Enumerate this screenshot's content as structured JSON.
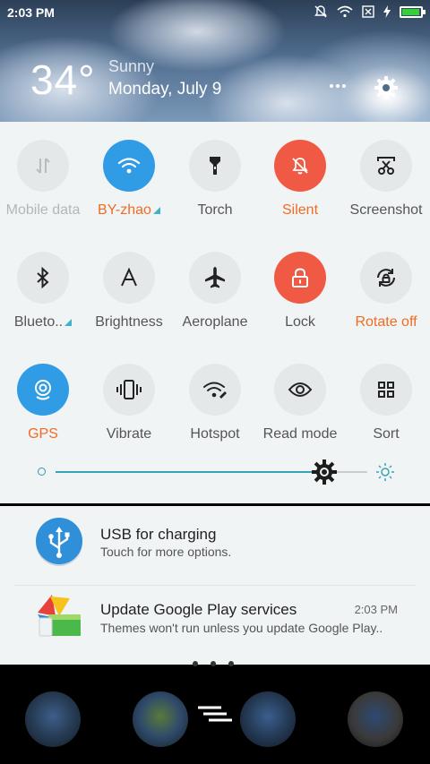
{
  "status_bar": {
    "time": "2:03 PM",
    "icons": [
      "mute-bell-icon",
      "wifi-icon",
      "no-sim-icon",
      "charging-icon",
      "battery-icon"
    ],
    "battery_color": "#35d036"
  },
  "weather": {
    "temperature": "34°",
    "condition": "Sunny",
    "date": "Monday, July 9"
  },
  "header_icons": [
    "more-icon",
    "gear-icon"
  ],
  "tiles": [
    {
      "label": "Mobile data",
      "icon": "mobile-data-icon",
      "state": "disabled"
    },
    {
      "label": "BY-zhao",
      "icon": "wifi-icon",
      "state": "on"
    },
    {
      "label": "Torch",
      "icon": "torch-icon",
      "state": "off"
    },
    {
      "label": "Silent",
      "icon": "silent-bell-icon",
      "state": "on"
    },
    {
      "label": "Screenshot",
      "icon": "scissors-icon",
      "state": "off"
    },
    {
      "label": "Blueto..",
      "icon": "bluetooth-icon",
      "state": "off"
    },
    {
      "label": "Brightness",
      "icon": "auto-brightness-icon",
      "state": "off"
    },
    {
      "label": "Aeroplane",
      "icon": "aeroplane-icon",
      "state": "off"
    },
    {
      "label": "Lock",
      "icon": "lock-icon",
      "state": "on"
    },
    {
      "label": "Rotate off",
      "icon": "rotate-lock-icon",
      "state": "on"
    },
    {
      "label": "GPS",
      "icon": "gps-icon",
      "state": "on"
    },
    {
      "label": "Vibrate",
      "icon": "vibrate-icon",
      "state": "off"
    },
    {
      "label": "Hotspot",
      "icon": "hotspot-icon",
      "state": "off"
    },
    {
      "label": "Read mode",
      "icon": "eye-icon",
      "state": "off"
    },
    {
      "label": "Sort",
      "icon": "grid-icon",
      "state": "off"
    }
  ],
  "brightness": {
    "level": 0.87
  },
  "colors": {
    "accent_blue": "#2f9ce5",
    "accent_red": "#f05a44",
    "active_label": "#f06c22",
    "slider_teal": "#37a4b3"
  },
  "notifications": [
    {
      "title": "USB for charging",
      "subtitle": "Touch for more options.",
      "time": "",
      "icon": "usb-icon"
    },
    {
      "title": "Update Google Play services",
      "subtitle": "Themes won't run unless you update Google Play..",
      "time": "2:03 PM",
      "icon": "themes-app-icon"
    }
  ],
  "dock_apps": [
    "phone-app-icon",
    "browser-app-icon",
    "messages-app-icon",
    "camera-app-icon"
  ]
}
